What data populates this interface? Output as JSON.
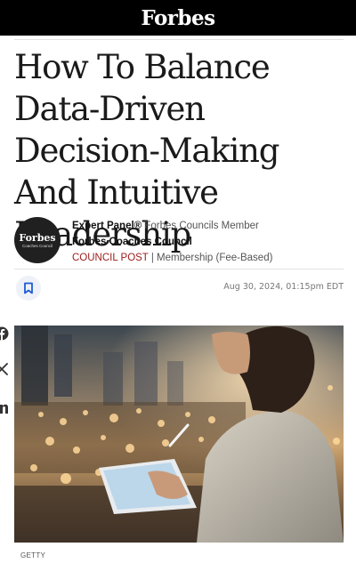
{
  "header": {
    "logo_text": "Forbes"
  },
  "article": {
    "headline": "How To Balance Data-Driven Decision-Making And Intuitive Leadership",
    "date": "Aug 30, 2024, 01:15pm EDT",
    "image_credit": "GETTY"
  },
  "author": {
    "avatar_brand": "Forbes",
    "avatar_sub": "Coaches Council",
    "panel_label": "Expert Panel®",
    "panel_role": "Forbes Councils Member",
    "council_name": "Forbes Coaches Council",
    "post_type": "COUNCIL POST",
    "separator": "|",
    "membership": "Membership (Fee-Based)"
  },
  "icons": {
    "bookmark": "bookmark-icon",
    "facebook": "facebook-icon",
    "x": "x-twitter-icon",
    "linkedin": "linkedin-icon"
  },
  "colors": {
    "topbar": "#000000",
    "council_post": "#9b1b1b",
    "bookmark_accent": "#1f5bd4"
  }
}
